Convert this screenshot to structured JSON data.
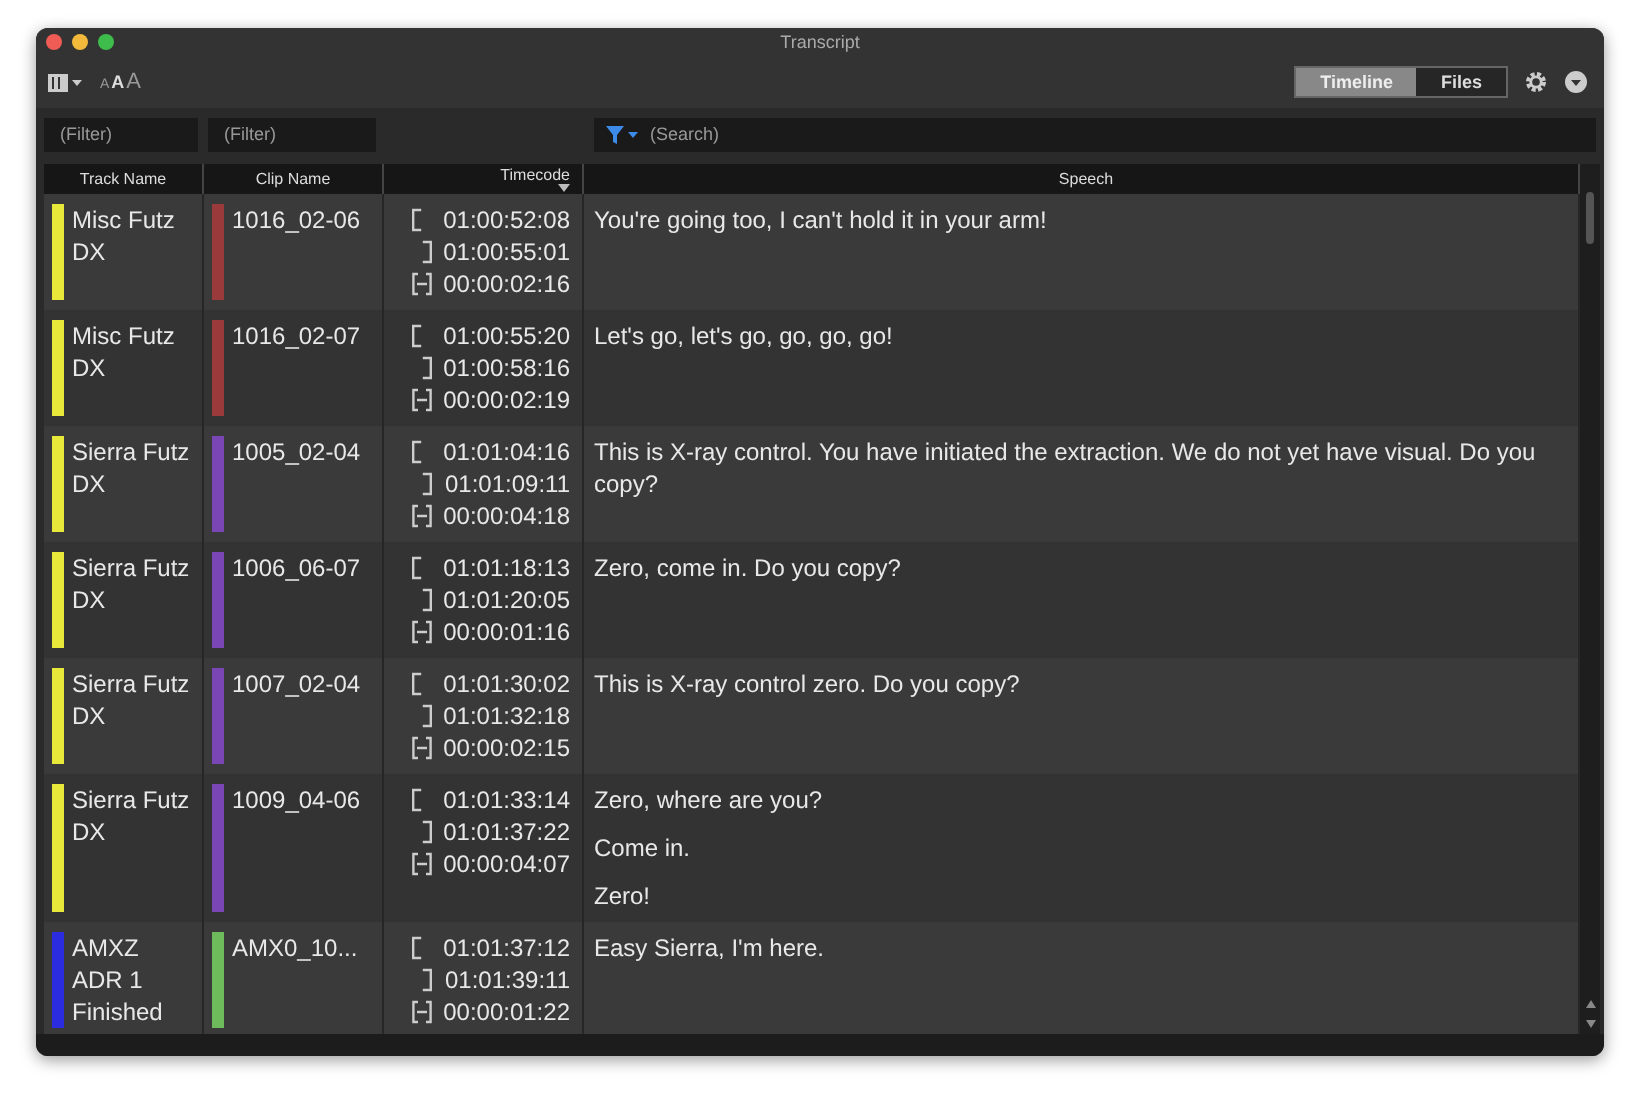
{
  "window": {
    "title": "Transcript"
  },
  "toolbar": {
    "text_size_buttons": [
      "A",
      "A",
      "A"
    ],
    "view_tabs": [
      {
        "label": "Timeline",
        "selected": true
      },
      {
        "label": "Files",
        "selected": false
      }
    ]
  },
  "filters": {
    "track_placeholder": "(Filter)",
    "clip_placeholder": "(Filter)",
    "search_placeholder": "(Search)"
  },
  "table": {
    "columns": [
      "Track Name",
      "Clip Name",
      "Timecode",
      "Speech"
    ],
    "rows": [
      {
        "track": {
          "name": "Misc Futz DX",
          "color": "#e8e83a"
        },
        "clip": {
          "name": "1016_02-06",
          "color": "#9b3a3a"
        },
        "tc_in": "01:00:52:08",
        "tc_out": "01:00:55:01",
        "duration": "00:00:02:16",
        "speech": [
          "You're going too, I can't hold it in your arm!"
        ]
      },
      {
        "track": {
          "name": "Misc Futz DX",
          "color": "#e8e83a"
        },
        "clip": {
          "name": "1016_02-07",
          "color": "#9b3a3a"
        },
        "tc_in": "01:00:55:20",
        "tc_out": "01:00:58:16",
        "duration": "00:00:02:19",
        "speech": [
          "Let's go, let's go, go, go, go!"
        ]
      },
      {
        "track": {
          "name": "Sierra Futz DX",
          "color": "#e8e83a"
        },
        "clip": {
          "name": "1005_02-04",
          "color": "#7a45b5"
        },
        "tc_in": "01:01:04:16",
        "tc_out": "01:01:09:11",
        "duration": "00:00:04:18",
        "speech": [
          "This is X-ray control. You have initiated the extraction. We do not yet have visual. Do you copy?"
        ]
      },
      {
        "track": {
          "name": "Sierra Futz DX",
          "color": "#e8e83a"
        },
        "clip": {
          "name": "1006_06-07",
          "color": "#7a45b5"
        },
        "tc_in": "01:01:18:13",
        "tc_out": "01:01:20:05",
        "duration": "00:00:01:16",
        "speech": [
          "Zero, come in. Do you copy?"
        ]
      },
      {
        "track": {
          "name": "Sierra Futz DX",
          "color": "#e8e83a"
        },
        "clip": {
          "name": "1007_02-04",
          "color": "#7a45b5"
        },
        "tc_in": "01:01:30:02",
        "tc_out": "01:01:32:18",
        "duration": "00:00:02:15",
        "speech": [
          "This is X-ray control zero. Do you copy?"
        ]
      },
      {
        "track": {
          "name": "Sierra Futz DX",
          "color": "#e8e83a"
        },
        "clip": {
          "name": "1009_04-06",
          "color": "#7a45b5"
        },
        "tc_in": "01:01:33:14",
        "tc_out": "01:01:37:22",
        "duration": "00:00:04:07",
        "speech": [
          "Zero, where are you?",
          "Come in.",
          "Zero!"
        ]
      },
      {
        "track": {
          "name": "AMXZ ADR 1 Finished",
          "color": "#2b2be0"
        },
        "clip": {
          "name": "AMX0_10...",
          "color": "#6dbb5a"
        },
        "tc_in": "01:01:37:12",
        "tc_out": "01:01:39:11",
        "duration": "00:00:01:22",
        "speech": [
          "Easy Sierra, I'm here."
        ]
      }
    ]
  }
}
